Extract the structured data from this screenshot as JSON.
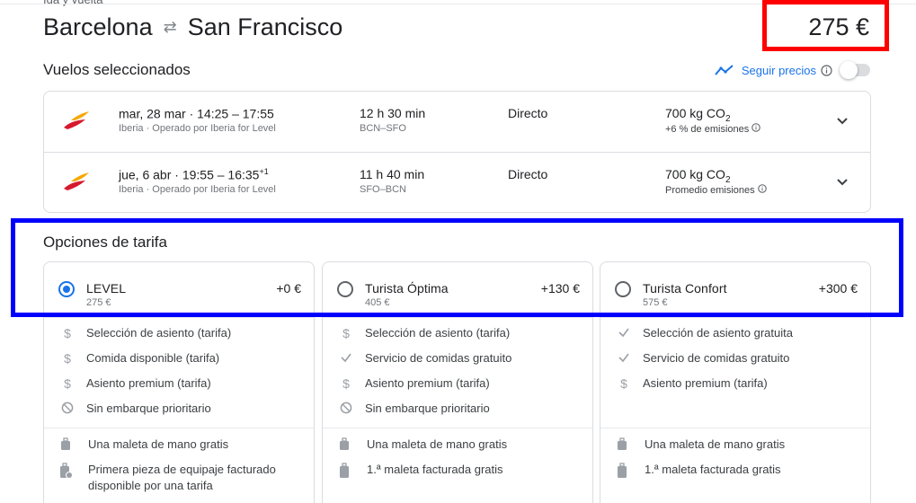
{
  "header": {
    "trip_type": "Ida y vuelta",
    "origin": "Barcelona",
    "destination": "San Francisco",
    "price": "275 €"
  },
  "selected_flights": {
    "title": "Vuelos seleccionados",
    "follow_prices_label": "Seguir precios",
    "follow_prices_on": false,
    "flights": [
      {
        "date": "mar, 28 mar",
        "times": "14:25 – 17:55",
        "day_offset": "",
        "airline": "Iberia · Operado por Iberia for Level",
        "duration": "12 h 30 min",
        "route": "BCN–SFO",
        "stops": "Directo",
        "co2_value": "700 kg CO",
        "co2_sub": "2",
        "emissions": "+6 % de emisiones"
      },
      {
        "date": "jue, 6 abr",
        "times": "19:55 – 16:35",
        "day_offset": "+1",
        "airline": "Iberia · Operado por Iberia for Level",
        "duration": "11 h 40 min",
        "route": "SFO–BCN",
        "stops": "Directo",
        "co2_value": "700 kg CO",
        "co2_sub": "2",
        "emissions": "Promedio emisiones"
      }
    ]
  },
  "fare_options": {
    "title": "Opciones de tarifa",
    "fares": [
      {
        "name": "LEVEL",
        "price": "275 €",
        "delta": "+0 €",
        "selected": true,
        "features": [
          {
            "icon": "dollar-icon",
            "text": "Selección de asiento (tarifa)"
          },
          {
            "icon": "dollar-icon",
            "text": "Comida disponible (tarifa)"
          },
          {
            "icon": "dollar-icon",
            "text": "Asiento premium (tarifa)"
          },
          {
            "icon": "no-icon",
            "text": "Sin embarque prioritario"
          }
        ],
        "bags": [
          {
            "icon": "carry-on-icon",
            "text": "Una maleta de mano gratis"
          },
          {
            "icon": "checked-bag-dollar-icon",
            "text": "Primera pieza de equipaje facturado disponible por una tarifa"
          }
        ]
      },
      {
        "name": "Turista Óptima",
        "price": "405 €",
        "delta": "+130 €",
        "selected": false,
        "features": [
          {
            "icon": "dollar-icon",
            "text": "Selección de asiento (tarifa)"
          },
          {
            "icon": "check-icon",
            "text": "Servicio de comidas gratuito"
          },
          {
            "icon": "dollar-icon",
            "text": "Asiento premium (tarifa)"
          },
          {
            "icon": "no-icon",
            "text": "Sin embarque prioritario"
          }
        ],
        "bags": [
          {
            "icon": "carry-on-icon",
            "text": "Una maleta de mano gratis"
          },
          {
            "icon": "checked-bag-icon",
            "text": "1.ª maleta facturada gratis"
          }
        ]
      },
      {
        "name": "Turista Confort",
        "price": "575 €",
        "delta": "+300 €",
        "selected": false,
        "features": [
          {
            "icon": "check-icon",
            "text": "Selección de asiento gratuita"
          },
          {
            "icon": "check-icon",
            "text": "Servicio de comidas gratuito"
          },
          {
            "icon": "dollar-icon",
            "text": "Asiento premium (tarifa)"
          }
        ],
        "bags": [
          {
            "icon": "carry-on-icon",
            "text": "Una maleta de mano gratis"
          },
          {
            "icon": "checked-bag-icon",
            "text": "1.ª maleta facturada gratis"
          }
        ]
      }
    ]
  },
  "highlight_colors": {
    "price_box": "#ff0000",
    "fare_row_box": "#0000ff"
  }
}
